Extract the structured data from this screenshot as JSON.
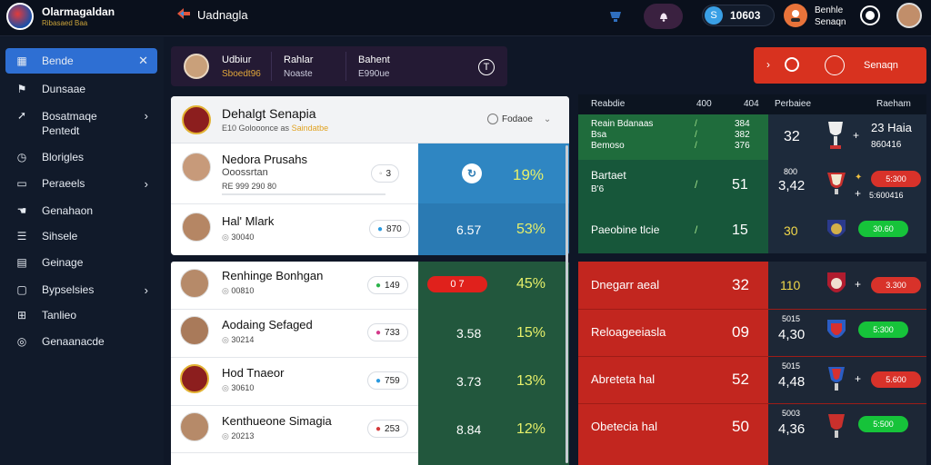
{
  "brand": {
    "name": "Olarmagaldan",
    "tagline": "Ribasaed Baa"
  },
  "header": {
    "crumb": "Uadnagla",
    "balance": "10603",
    "balance_icon": "S",
    "user_label_1": "Benhle",
    "user_label_2": "Senaqn"
  },
  "sidebar": {
    "items": [
      {
        "label": "Bende",
        "icon": "home-icon",
        "active": true
      },
      {
        "label": "Dunsaae",
        "icon": "flag-icon"
      },
      {
        "label": "Bosatmaqe",
        "icon": "arrow-icon",
        "sub": "Pentedt"
      },
      {
        "label": "Blorigles",
        "icon": "clock-icon"
      },
      {
        "label": "Peraeels",
        "icon": "card-icon"
      },
      {
        "label": "Genahaon",
        "icon": "hand-icon"
      },
      {
        "label": "Sihsele",
        "icon": "list-icon"
      },
      {
        "label": "Geinage",
        "icon": "calendar-icon"
      },
      {
        "label": "Bypselsies",
        "icon": "doc-icon"
      },
      {
        "label": "Tanlieo",
        "icon": "grid-icon"
      },
      {
        "label": "Genaanacde",
        "icon": "globe-icon"
      }
    ]
  },
  "topstrip": {
    "t1": "Udbiur",
    "t1s": "Sboedt96",
    "t2": "Rahlar",
    "t2s": "Noaste",
    "t3": "Bahent",
    "t3s": "E990ue",
    "t_btn": "T"
  },
  "match_head": {
    "title": "Dehalgt Senapia",
    "sub": "E10 Golooonce as",
    "sub_hl": "Saindatbe",
    "select": "Fodaoe"
  },
  "rows_top": [
    {
      "name": "Nedora Prusahs",
      "sub1": "Ooossrtan",
      "sub2": "RE 999 290 80",
      "tag": "3"
    },
    {
      "name": "Hal' Mlark",
      "sub": "30040",
      "tag": "870"
    }
  ],
  "odds_top": [
    {
      "a": "",
      "b": "19%"
    },
    {
      "a": "6.57",
      "b": "53%"
    }
  ],
  "rows_bottom": [
    {
      "name": "Renhinge Bonhgan",
      "sub": "00810",
      "tag": "149",
      "odds_a": "0 7",
      "odds_b": "45%"
    },
    {
      "name": "Aodaing Sefaged",
      "sub": "30214",
      "tag": "733",
      "odds_a": "3.58",
      "odds_b": "15%"
    },
    {
      "name": "Hod Tnaeor",
      "sub": "30610",
      "tag": "759",
      "odds_a": "3.73",
      "odds_b": "13%"
    },
    {
      "name": "Kenthueone Simagia",
      "sub": "20213",
      "tag": "253",
      "odds_a": "8.84",
      "odds_b": "12%"
    }
  ],
  "rt_header": {
    "c1": "Reabdie",
    "c2": "400",
    "c3": "404",
    "c4": "Perbaiee",
    "c5": "Raeham"
  },
  "rt_green": [
    {
      "name": "Reain Bdanaas",
      "name2": "Bsa",
      "name3": "Bemoso",
      "v1": "384",
      "v2": "382",
      "v3": "376",
      "score": "32",
      "val": "23 Haia",
      "val2": "860416"
    },
    {
      "name": "Bartaet",
      "name2": "B'6",
      "v": "51",
      "score": "3,42",
      "tag": "5:300",
      "val2": "5:600416",
      "sub": "800"
    },
    {
      "name": "Paeobine tlcie",
      "v": "15",
      "score": "30",
      "tag": "30.60"
    }
  ],
  "rt_red": [
    {
      "name": "Dnegarr aeal",
      "v": "32",
      "score": "110",
      "tag": "3.300"
    },
    {
      "name": "Reloageeiasla",
      "v": "09",
      "score": "4,30",
      "sub": "5015",
      "tag": "5:300"
    },
    {
      "name": "Abreteta hal",
      "v": "52",
      "score": "4,48",
      "sub": "5015",
      "tag": "5.600"
    },
    {
      "name": "Obetecia hal",
      "v": "50",
      "score": "4,36",
      "sub": "5003",
      "tag": "5:500"
    }
  ],
  "colors": {
    "accent": "#2e6fd3",
    "green": "#16c33a",
    "red": "#d8322a"
  }
}
